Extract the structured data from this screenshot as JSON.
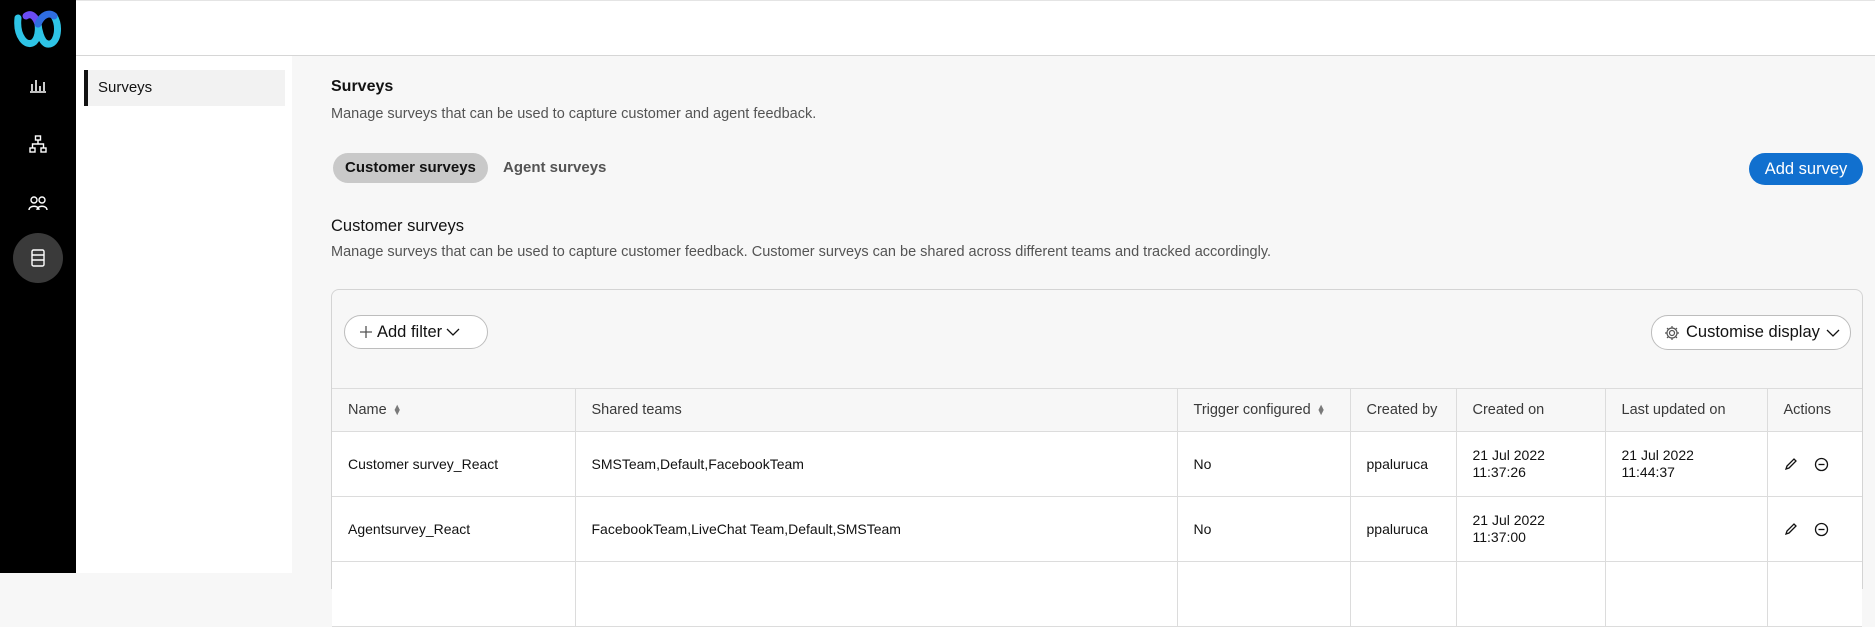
{
  "sidenav": {
    "items": [
      {
        "label": "Surveys"
      }
    ]
  },
  "page": {
    "title": "Surveys",
    "description": "Manage surveys that can be used to capture customer and agent feedback."
  },
  "tabs": [
    {
      "label": "Customer surveys",
      "active": true
    },
    {
      "label": "Agent surveys",
      "active": false
    }
  ],
  "add_survey_label": "Add survey",
  "section": {
    "title": "Customer surveys",
    "description": "Manage surveys that can be used to capture customer feedback. Customer surveys can be shared across different teams and tracked accordingly."
  },
  "toolbar": {
    "add_filter_label": "Add filter",
    "customise_display_label": "Customise display"
  },
  "table": {
    "columns": [
      "Name",
      "Shared teams",
      "Trigger configured",
      "Created by",
      "Created on",
      "Last updated on",
      "Actions"
    ],
    "rows": [
      {
        "name": "Customer survey_React",
        "shared_teams": "SMSTeam,Default,FacebookTeam",
        "trigger": "No",
        "created_by": "ppaluruca",
        "created_on_date": "21 Jul 2022",
        "created_on_time": "11:37:26",
        "updated_on_date": "21 Jul 2022",
        "updated_on_time": "11:44:37"
      },
      {
        "name": "Agentsurvey_React",
        "shared_teams": "FacebookTeam,LiveChat Team,Default,SMSTeam",
        "trigger": "No",
        "created_by": "ppaluruca",
        "created_on_date": "21 Jul 2022",
        "created_on_time": "11:37:00",
        "updated_on_date": "",
        "updated_on_time": ""
      }
    ]
  },
  "colors": {
    "accent": "#1170cf",
    "rail": "#000000",
    "active_tab": "#c9c9c9"
  },
  "icons": [
    "webex-logo",
    "analytics-icon",
    "flow-icon",
    "teams-icon",
    "survey-icon",
    "plus-icon",
    "chevron-down-icon",
    "gear-icon",
    "sort-icon",
    "edit-icon",
    "remove-icon"
  ]
}
